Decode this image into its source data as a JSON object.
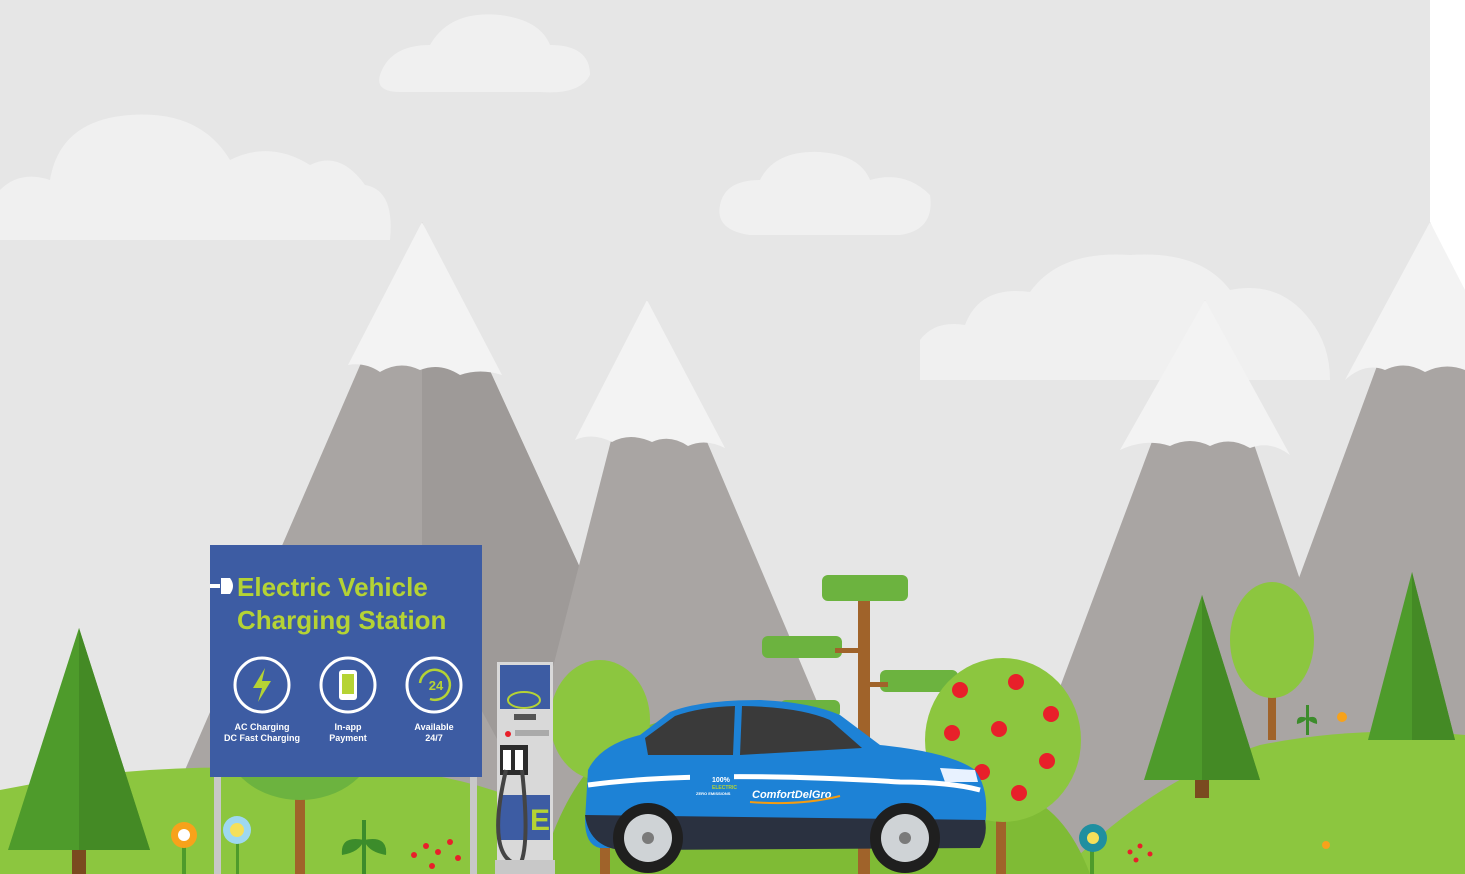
{
  "sign": {
    "title_line1": "Electric Vehicle",
    "title_line2": "Charging Station",
    "features": [
      {
        "icon": "lightning-icon",
        "line1": "AC Charging",
        "line2": "DC Fast Charging"
      },
      {
        "icon": "phone-icon",
        "line1": "In-app",
        "line2": "Payment"
      },
      {
        "icon": "clock-24-icon",
        "line1": "Available",
        "line2": "24/7",
        "badge": "24"
      }
    ]
  },
  "car": {
    "brand": "ComfortDelGro",
    "badge_percent": "100%",
    "badge_word": "ELECTRIC",
    "badge_sub": "ZERO EMISSIONS"
  },
  "charger": {
    "letter": "E"
  },
  "colors": {
    "sky": "#e7e7e7",
    "mountain": "#a9a6a4",
    "snow": "#f2f2f2",
    "sign_blue": "#3d5ca3",
    "sign_text": "#b5d334",
    "car_blue": "#1d82d6",
    "grass": "#8cc63f",
    "tree_dark": "#4d9a2a"
  }
}
